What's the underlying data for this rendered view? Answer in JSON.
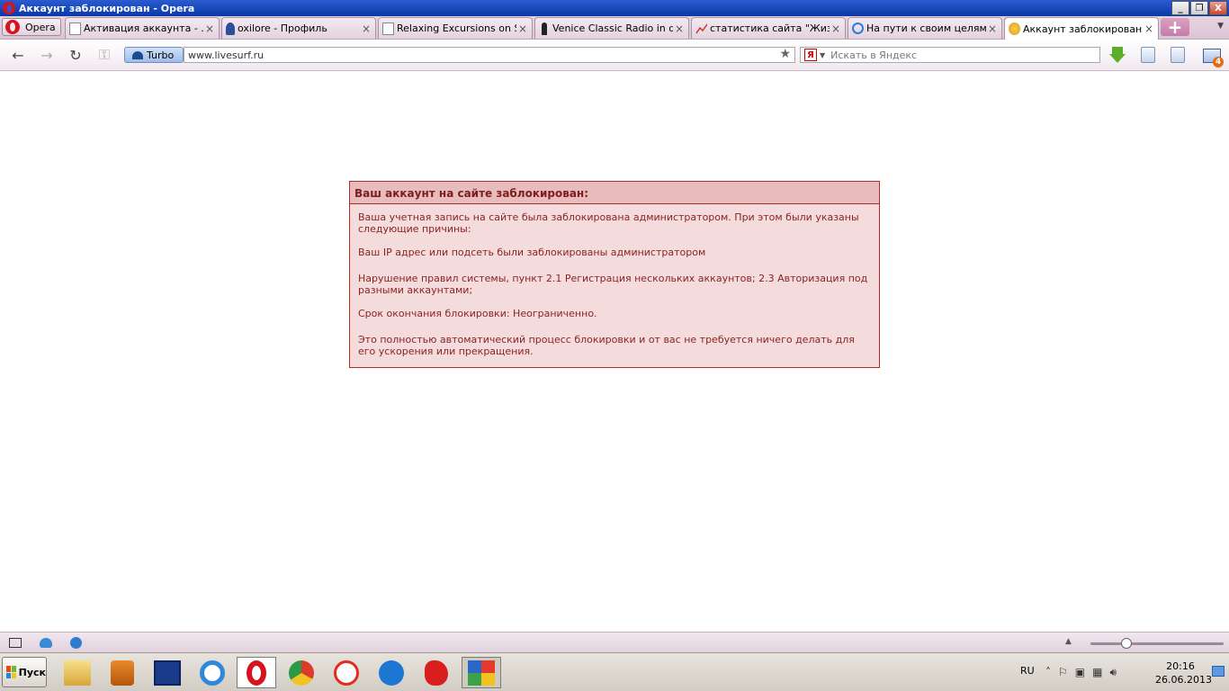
{
  "window": {
    "title": "Аккаунт заблокирован - Opera",
    "controls": {
      "minimize": "_",
      "restore": "❐",
      "close": "X"
    }
  },
  "browser": {
    "menu_label": "Opera",
    "tabs": [
      {
        "label": "Активация аккаунта - ...",
        "icon": "page-icon",
        "active": false
      },
      {
        "label": "oxilore - Профиль",
        "icon": "profile-icon",
        "active": false
      },
      {
        "label": "Relaxing Excursions on S...",
        "icon": "page-icon",
        "active": false
      },
      {
        "label": "Venice Classic Radio in di...",
        "icon": "radio-icon",
        "active": false
      },
      {
        "label": "статистика сайта \"Жиз...",
        "icon": "chart-icon",
        "active": false
      },
      {
        "label": "На пути к своим целям!...",
        "icon": "globe-icon",
        "active": false
      },
      {
        "label": "Аккаунт заблокирован",
        "icon": "livesurf-icon",
        "active": true
      }
    ],
    "tab_close": "×",
    "new_tab": "+",
    "turbo_label": "Turbo",
    "address": "www.livesurf.ru",
    "search_placeholder": "Искать в Яндекс",
    "search_engine_badge": "Я",
    "mail_count": "4"
  },
  "page": {
    "header": "Ваш аккаунт на сайте заблокирован:",
    "paragraphs": [
      "Ваша учетная запись на сайте была заблокирована администратором. При этом были указаны следующие причины:",
      "Ваш IP адрес или подсеть были заблокированы администратором",
      "Нарушение правил системы, пункт 2.1 Регистрация нескольких аккаунтов; 2.3 Авторизация под разными аккаунтами;",
      "Срок окончания блокировки: Неограниченно.",
      "Это полностью автоматический процесс блокировки и от вас не требуется ничего делать для его ускорения или прекращения."
    ]
  },
  "taskbar": {
    "start_label": "Пуск",
    "apps": [
      "explorer-icon",
      "media-player-icon",
      "save-disk-icon",
      "internet-explorer-icon",
      "opera-icon",
      "chrome-icon",
      "yandex-browser-icon",
      "z-app-icon",
      "paint-splat-icon",
      "avg-icon"
    ],
    "language": "RU",
    "time": "20:16",
    "date": "26.06.2013"
  }
}
